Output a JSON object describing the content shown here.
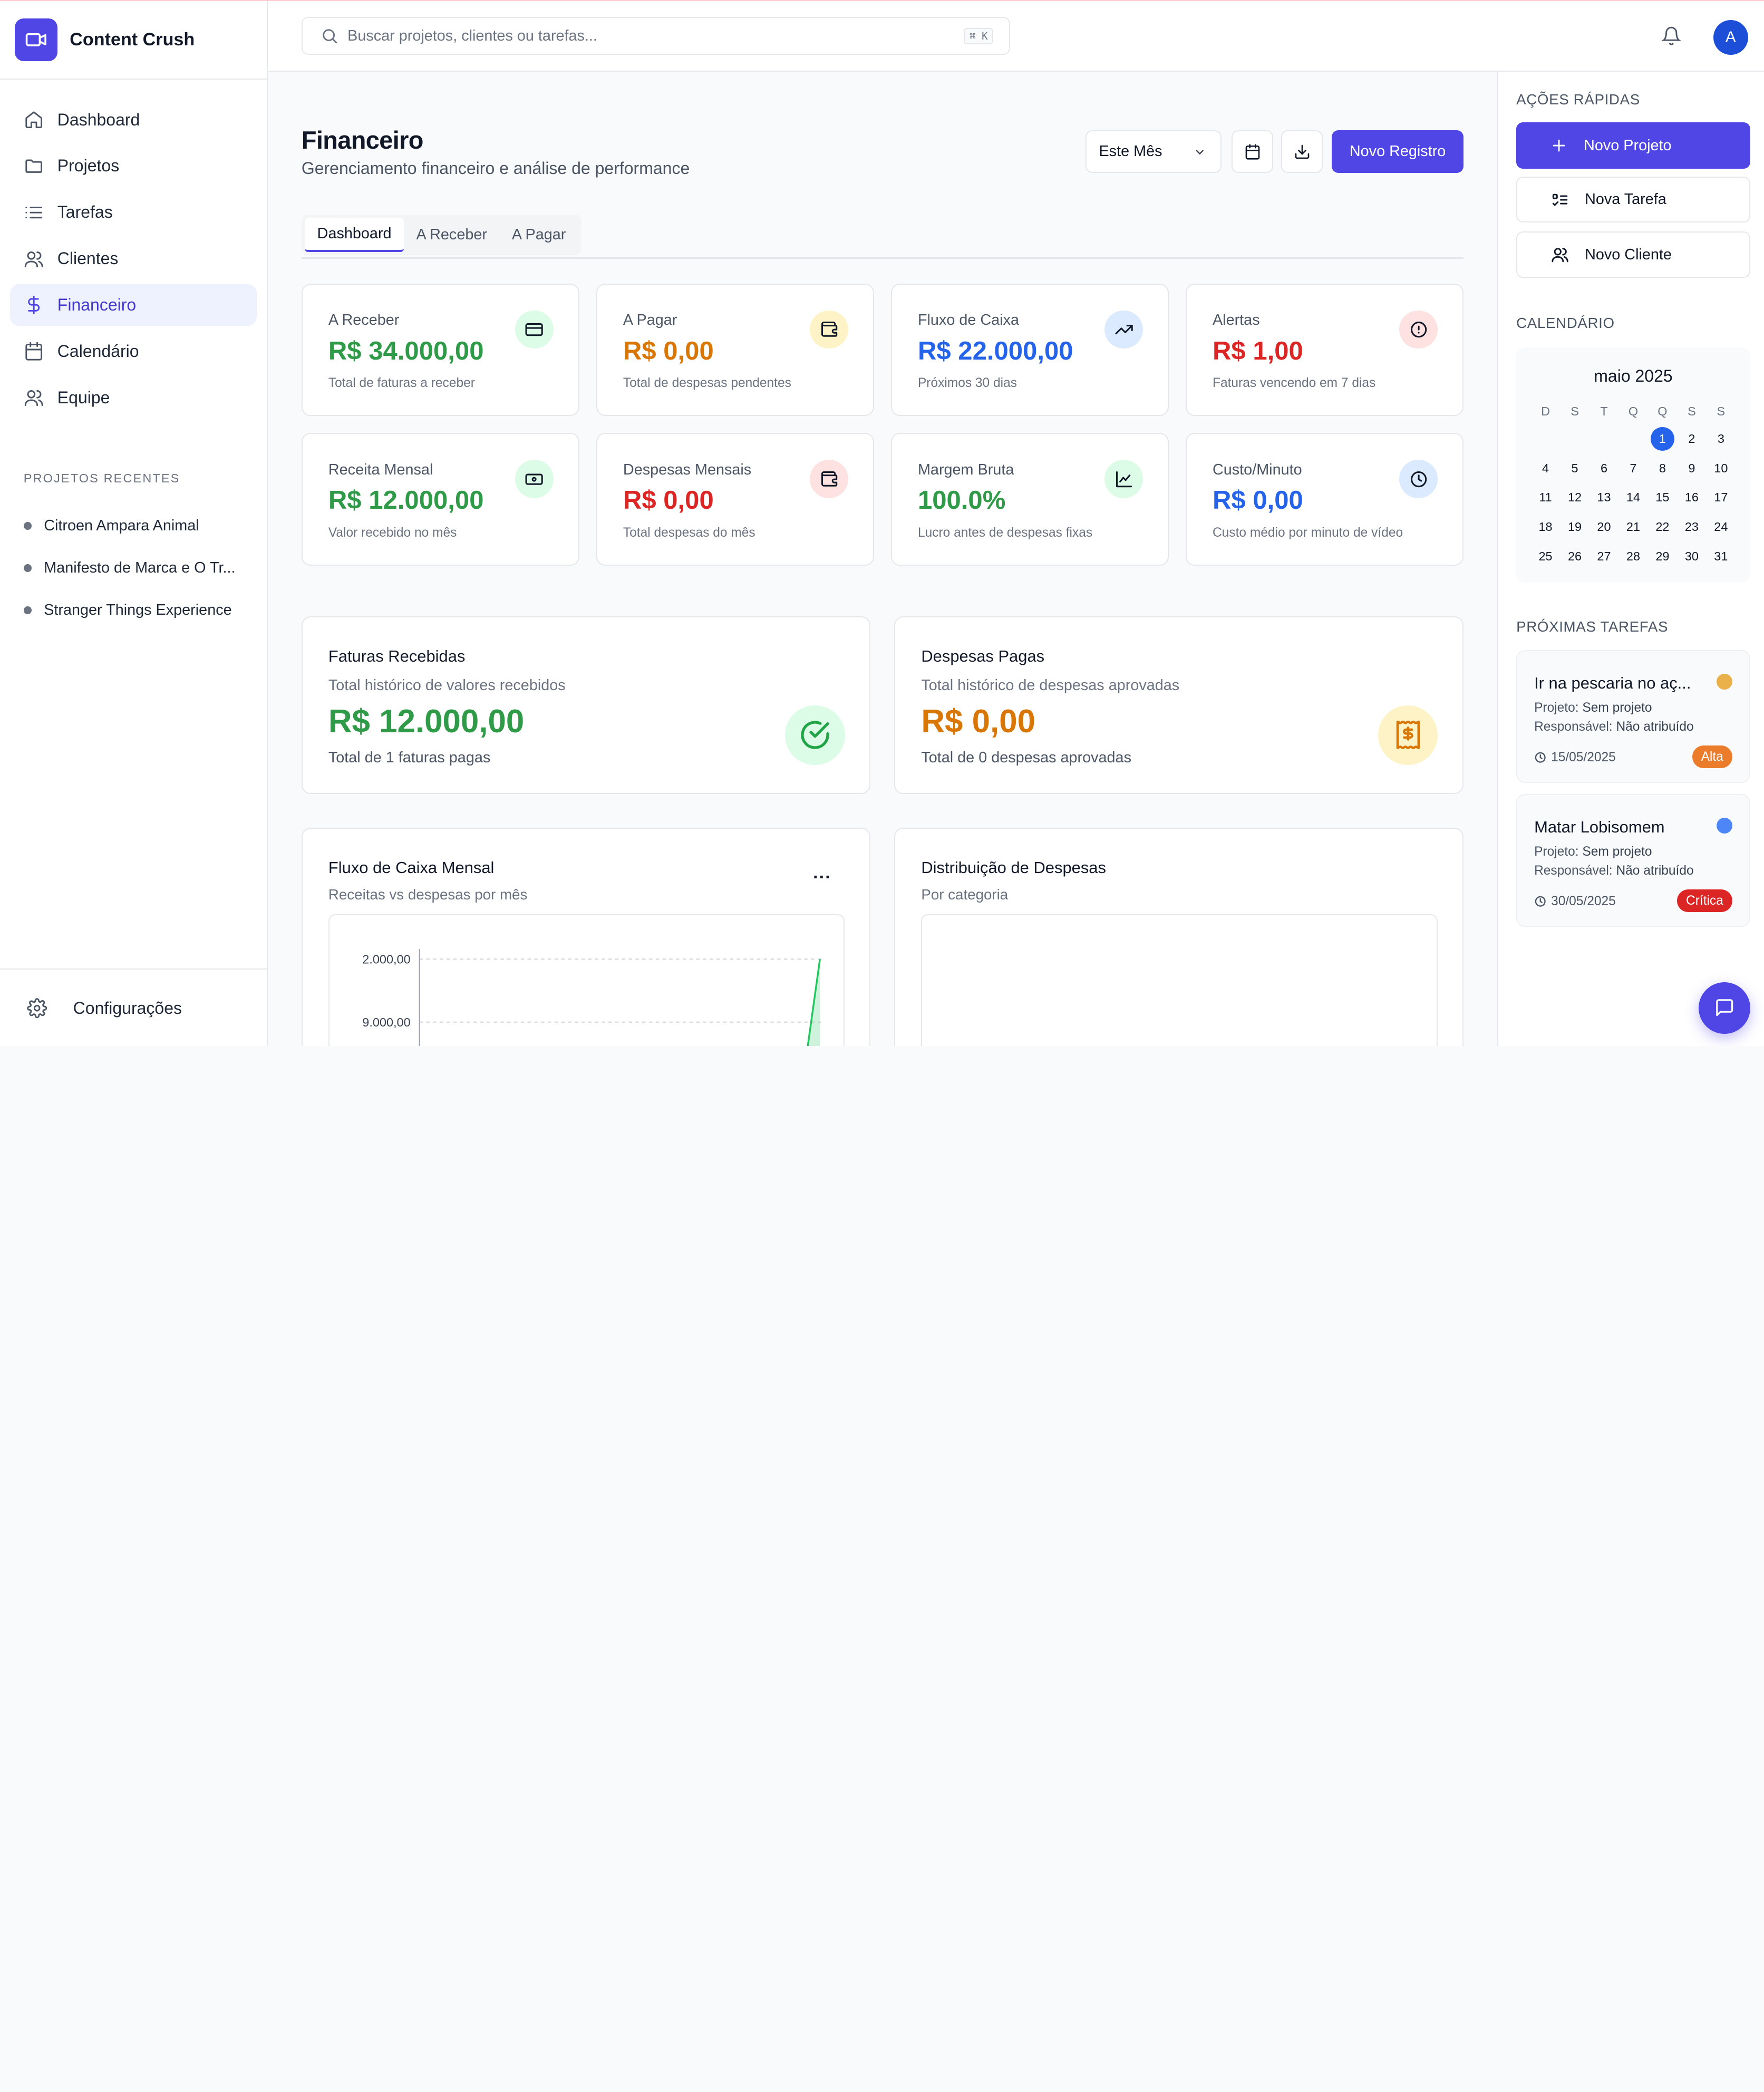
{
  "app": {
    "name": "Content Crush"
  },
  "sidebar": {
    "items": [
      {
        "label": "Dashboard",
        "icon": "home-icon"
      },
      {
        "label": "Projetos",
        "icon": "folder-icon"
      },
      {
        "label": "Tarefas",
        "icon": "list-icon"
      },
      {
        "label": "Clientes",
        "icon": "users-icon"
      },
      {
        "label": "Financeiro",
        "icon": "dollar-icon",
        "active": true
      },
      {
        "label": "Calendário",
        "icon": "calendar-icon"
      },
      {
        "label": "Equipe",
        "icon": "team-icon"
      }
    ],
    "recent_title": "PROJETOS RECENTES",
    "recent": [
      "Citroen Ampara Animal",
      "Manifesto de Marca e O Tr...",
      "Stranger Things Experience"
    ],
    "footer_label": "Configurações"
  },
  "header": {
    "search_placeholder": "Buscar projetos, clientes ou tarefas...",
    "shortcut": "⌘ K",
    "avatar_initial": "A"
  },
  "page": {
    "title": "Financeiro",
    "subtitle": "Gerenciamento financeiro e análise de performance",
    "period": "Este Mês",
    "primary_action": "Novo Registro",
    "tabs": [
      "Dashboard",
      "A Receber",
      "A Pagar"
    ]
  },
  "kpis": [
    {
      "label": "A Receber",
      "value": "R$ 34.000,00",
      "note": "Total de faturas a receber",
      "color": "#2f9a48",
      "icon": "credit-card-icon",
      "icon_bg": "#dcfce7"
    },
    {
      "label": "A Pagar",
      "value": "R$ 0,00",
      "note": "Total de despesas pendentes",
      "color": "#d97706",
      "icon": "wallet-icon",
      "icon_bg": "#fef3c7"
    },
    {
      "label": "Fluxo de Caixa",
      "value": "R$ 22.000,00",
      "note": "Próximos 30 dias",
      "color": "#2563eb",
      "icon": "trending-up-icon",
      "icon_bg": "#dbeafe"
    },
    {
      "label": "Alertas",
      "value": "R$ 1,00",
      "note": "Faturas vencendo em 7 dias",
      "color": "#dc2626",
      "icon": "alert-circle-icon",
      "icon_bg": "#fee2e2"
    },
    {
      "label": "Receita Mensal",
      "value": "R$ 12.000,00",
      "note": "Valor recebido no mês",
      "color": "#2f9a48",
      "icon": "banknote-icon",
      "icon_bg": "#dcfce7"
    },
    {
      "label": "Despesas Mensais",
      "value": "R$ 0,00",
      "note": "Total despesas do mês",
      "color": "#dc2626",
      "icon": "wallet-icon",
      "icon_bg": "#fee2e2"
    },
    {
      "label": "Margem Bruta",
      "value": "100.0%",
      "note": "Lucro antes de despesas fixas",
      "color": "#2f9a48",
      "icon": "line-chart-icon",
      "icon_bg": "#dcfce7"
    },
    {
      "label": "Custo/Minuto",
      "value": "R$ 0,00",
      "note": "Custo médio por minuto de vídeo",
      "color": "#2563eb",
      "icon": "clock-icon",
      "icon_bg": "#dbeafe"
    }
  ],
  "summary": [
    {
      "title": "Faturas Recebidas",
      "subtitle": "Total histórico de valores recebidos",
      "value": "R$ 12.000,00",
      "note": "Total de 1 faturas pagas",
      "color": "#2f9a48",
      "icon": "check-circle-icon",
      "icon_bg": "#dcfce7"
    },
    {
      "title": "Despesas Pagas",
      "subtitle": "Total histórico de despesas aprovadas",
      "value": "R$ 0,00",
      "note": "Total de 0 despesas aprovadas",
      "color": "#d97706",
      "icon": "receipt-icon",
      "icon_bg": "#fef3c7"
    }
  ],
  "charts": {
    "cashflow": {
      "title": "Fluxo de Caixa Mensal",
      "subtitle": "Receitas vs despesas por mês",
      "more": "..."
    },
    "expenses": {
      "title": "Distribuição de Despesas",
      "subtitle": "Por categoria"
    }
  },
  "chart_data": {
    "type": "area",
    "ytick_labels": [
      "2.000,00",
      "9.000,00"
    ],
    "series": [
      {
        "values": [
          0,
          0,
          0,
          0,
          0,
          0,
          0,
          0,
          0,
          0,
          0,
          12000
        ]
      }
    ],
    "grid": true,
    "color": "#22c55e"
  },
  "rail": {
    "quick_title": "AÇÕES RÁPIDAS",
    "quick": [
      "Novo Projeto",
      "Nova Tarefa",
      "Novo Cliente"
    ],
    "calendar_title": "CALENDÁRIO",
    "calendar": {
      "month": "maio 2025",
      "weekdays": [
        "D",
        "S",
        "T",
        "Q",
        "Q",
        "S",
        "S"
      ],
      "first_weekday": 4,
      "days": 31,
      "selected": 1
    },
    "tasks_title": "PRÓXIMAS TAREFAS",
    "tasks": [
      {
        "title": "Ir na pescaria no aç...",
        "project_label": "Projeto:",
        "project": "Sem projeto",
        "owner_label": "Responsável:",
        "owner": "Não atribuído",
        "date": "15/05/2025",
        "priority": "Alta",
        "priority_color": "#ea7c2c",
        "dot_color": "#eab14a"
      },
      {
        "title": "Matar Lobisomem",
        "project_label": "Projeto:",
        "project": "Sem projeto",
        "owner_label": "Responsável:",
        "owner": "Não atribuído",
        "date": "30/05/2025",
        "priority": "Crítica",
        "priority_color": "#dc2626",
        "dot_color": "#4f86f7"
      }
    ]
  }
}
